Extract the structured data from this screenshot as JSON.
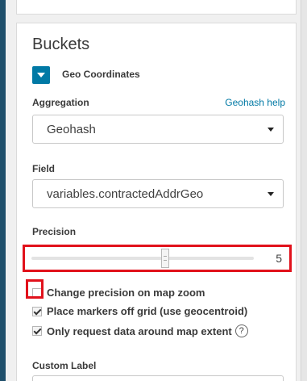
{
  "buckets": {
    "title": "Buckets",
    "agg_type": "Geo Coordinates"
  },
  "aggregation": {
    "label": "Aggregation",
    "help_link": "Geohash help",
    "selected": "Geohash"
  },
  "field": {
    "label": "Field",
    "selected": "variables.contractedAddrGeo"
  },
  "precision": {
    "label": "Precision",
    "value": "5",
    "fraction": 0.6
  },
  "options": [
    {
      "label": "Change precision on map zoom",
      "checked": false
    },
    {
      "label": "Place markers off grid (use geocentroid)",
      "checked": true
    },
    {
      "label": "Only request data around map extent",
      "checked": true
    }
  ],
  "custom_label": {
    "label": "Custom Label",
    "value": ""
  },
  "colors": {
    "accent": "#0079a5",
    "highlight": "#e1111b",
    "rail": "#1f4f6b"
  }
}
